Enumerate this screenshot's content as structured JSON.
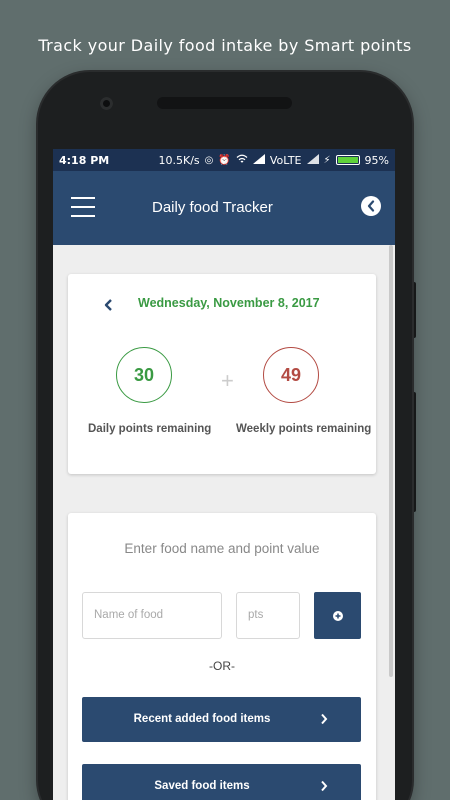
{
  "caption": "Track your Daily food intake by Smart points",
  "status_bar": {
    "time": "4:18 PM",
    "network_speed": "10.5K/s",
    "network_type": "VoLTE",
    "battery": "95%",
    "battery_level": 0.95
  },
  "app_bar": {
    "title": "Daily food Tracker",
    "menu_icon": "hamburger-menu-icon",
    "back_icon": "back-arrow-circle-icon"
  },
  "points_card": {
    "date": "Wednesday, November 8, 2017",
    "daily_points": "30",
    "daily_label": "Daily points remaining",
    "plus_symbol": "+",
    "weekly_points": "49",
    "weekly_label": "Weekly points remaining"
  },
  "food_entry": {
    "title": "Enter food name and point value",
    "food_name_placeholder": "Name of food",
    "points_placeholder": "pts",
    "or_text": "-OR-",
    "recent_button": "Recent added food items",
    "saved_button": "Saved food items"
  },
  "colors": {
    "app_bar": "#2b4a70",
    "status_bar": "#1c3152",
    "daily_green": "#3a9a43",
    "weekly_red": "#b34b43",
    "background": "#606e6d"
  }
}
